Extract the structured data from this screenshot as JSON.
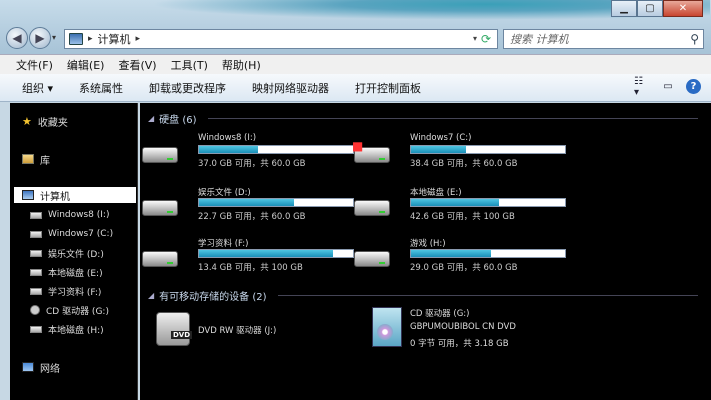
{
  "address": {
    "path": "计算机"
  },
  "search": {
    "placeholder": "搜索 计算机"
  },
  "menu": [
    "文件(F)",
    "编辑(E)",
    "查看(V)",
    "工具(T)",
    "帮助(H)"
  ],
  "toolbar": [
    "组织 ▾",
    "系统属性",
    "卸载或更改程序",
    "映射网络驱动器",
    "打开控制面板"
  ],
  "sidebar": {
    "favorites": "收藏夹",
    "libraries": "库",
    "computer": "计算机",
    "drives": [
      "Windows8 (I:)",
      "Windows7 (C:)",
      "娱乐文件 (D:)",
      "本地磁盘 (E:)",
      "学习资料 (F:)",
      "CD 驱动器 (G:)",
      "本地磁盘 (H:)"
    ],
    "network": "网络"
  },
  "groups": {
    "hdd": "硬盘 (6)",
    "removable": "有可移动存储的设备 (2)"
  },
  "drives": [
    {
      "name": "Windows8 (I:)",
      "free": "37.0 GB 可用，共 60.0 GB",
      "used_fraction": 0.38
    },
    {
      "name": "Windows7 (C:)",
      "free": "38.4 GB 可用，共 60.0 GB",
      "used_fraction": 0.36
    },
    {
      "name": "娱乐文件 (D:)",
      "free": "22.7 GB 可用，共 60.0 GB",
      "used_fraction": 0.62
    },
    {
      "name": "本地磁盘 (E:)",
      "free": "42.6 GB 可用，共 100 GB",
      "used_fraction": 0.57
    },
    {
      "name": "学习资料 (F:)",
      "free": "13.4 GB 可用，共 100 GB",
      "used_fraction": 0.87
    },
    {
      "name": "游戏 (H:)",
      "free": "29.0 GB 可用，共 60.0 GB",
      "used_fraction": 0.52
    }
  ],
  "optical": [
    {
      "name": "DVD RW 驱动器 (J:)",
      "line2": "",
      "line3": "",
      "label": "DVD"
    },
    {
      "name": "CD 驱动器 (G:)",
      "line2": "GBPUMOUBIBOL CN DVD",
      "line3": "0 字节 可用，共 3.18 GB",
      "label": ""
    }
  ]
}
